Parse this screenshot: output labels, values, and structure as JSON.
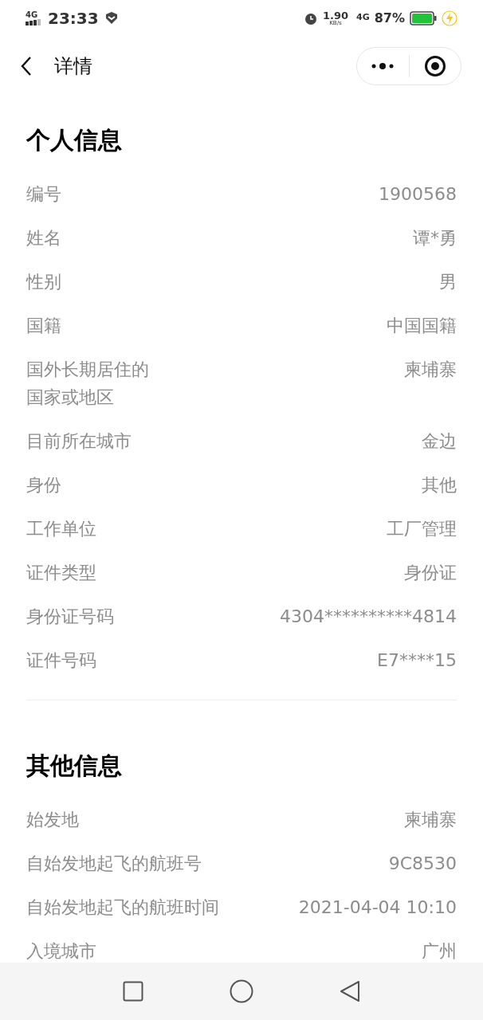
{
  "status_bar": {
    "network": "4G",
    "time": "23:33",
    "speed": "1.90",
    "speed_unit": "KB/s",
    "network_right": "4G",
    "battery": "87%"
  },
  "header": {
    "title": "详情"
  },
  "sections": [
    {
      "title": "个人信息",
      "rows": [
        {
          "label": "编号",
          "value": "1900568"
        },
        {
          "label": "姓名",
          "value": "谭*勇"
        },
        {
          "label": "性别",
          "value": "男"
        },
        {
          "label": "国籍",
          "value": "中国国籍"
        },
        {
          "label": "国外长期居住的国家或地区",
          "value": "柬埔寨",
          "kind": "narrow"
        },
        {
          "label": "目前所在城市",
          "value": "金边"
        },
        {
          "label": "身份",
          "value": "其他"
        },
        {
          "label": "工作单位",
          "value": "工厂管理"
        },
        {
          "label": "证件类型",
          "value": "身份证"
        },
        {
          "label": "身份证号码",
          "value": "4304**********4814"
        },
        {
          "label": "证件号码",
          "value": "E7****15"
        }
      ]
    },
    {
      "title": "其他信息",
      "rows": [
        {
          "label": "始发地",
          "value": "柬埔寨"
        },
        {
          "label": "自始发地起飞的航班号",
          "value": "9C8530"
        },
        {
          "label": "自始发地起飞的航班时间",
          "value": "2021-04-04 10:10"
        },
        {
          "label": "入境城市",
          "value": "广州"
        }
      ]
    }
  ]
}
